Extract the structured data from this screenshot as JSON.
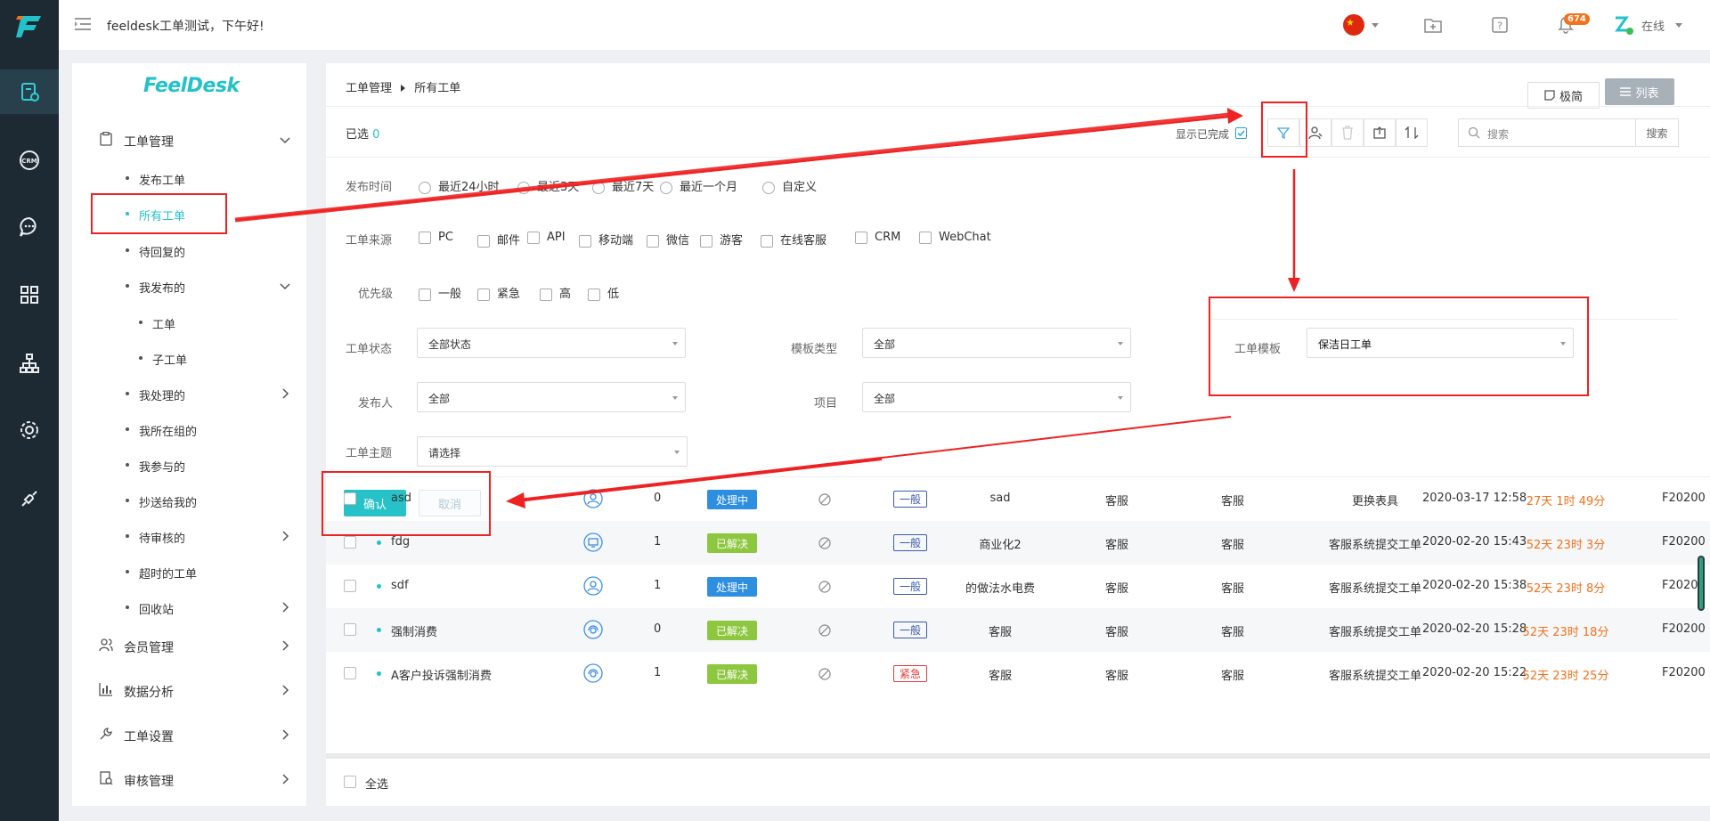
{
  "topbar": {
    "greeting": "feeldesk工单测试，下午好!",
    "notification_count": "674",
    "status": "在线"
  },
  "sidebar": {
    "brand": "FeelDesk",
    "items": [
      {
        "label": "工单管理",
        "icon": "ticket-icon",
        "level": 0,
        "arrow": "down"
      },
      {
        "label": "发布工单",
        "level": 1
      },
      {
        "label": "所有工单",
        "level": 1,
        "active": true
      },
      {
        "label": "待回复的",
        "level": 1
      },
      {
        "label": "我发布的",
        "level": 1,
        "arrow": "down"
      },
      {
        "label": "工单",
        "level": 2
      },
      {
        "label": "子工单",
        "level": 2
      },
      {
        "label": "我处理的",
        "level": 1,
        "arrow": "right"
      },
      {
        "label": "我所在组的",
        "level": 1
      },
      {
        "label": "我参与的",
        "level": 1
      },
      {
        "label": "抄送给我的",
        "level": 1
      },
      {
        "label": "待审核的",
        "level": 1,
        "arrow": "right"
      },
      {
        "label": "超时的工单",
        "level": 1
      },
      {
        "label": "回收站",
        "level": 1,
        "arrow": "right"
      },
      {
        "label": "会员管理",
        "icon": "members-icon",
        "level": 0,
        "arrow": "right"
      },
      {
        "label": "数据分析",
        "icon": "chart-icon",
        "level": 0,
        "arrow": "right"
      },
      {
        "label": "工单设置",
        "icon": "wrench-icon",
        "level": 0,
        "arrow": "right"
      },
      {
        "label": "审核管理",
        "icon": "audit-icon",
        "level": 0,
        "arrow": "right"
      }
    ]
  },
  "breadcrumb": {
    "root": "工单管理",
    "current": "所有工单"
  },
  "view": {
    "simple": "极简",
    "list": "列表"
  },
  "toolbar": {
    "selected_label": "已选",
    "selected_count": "0",
    "show_done": "显示已完成",
    "search_placeholder": "搜索",
    "search_button": "搜索"
  },
  "filters": {
    "publish_time": {
      "label": "发布时间",
      "options": [
        "最近24小时",
        "最近3天",
        "最近7天",
        "最近一个月",
        "自定义"
      ]
    },
    "source": {
      "label": "工单来源",
      "options": [
        "PC",
        "邮件",
        "API",
        "移动端",
        "微信",
        "游客",
        "在线客服",
        "CRM",
        "WebChat"
      ]
    },
    "priority": {
      "label": "优先级",
      "options": [
        "一般",
        "紧急",
        "高",
        "低"
      ]
    },
    "status": {
      "label": "工单状态",
      "value": "全部状态"
    },
    "template_type": {
      "label": "模板类型",
      "value": "全部"
    },
    "template": {
      "label": "工单模板",
      "value": "保洁日工单"
    },
    "publisher": {
      "label": "发布人",
      "value": "全部"
    },
    "project": {
      "label": "项目",
      "value": "全部"
    },
    "subject": {
      "label": "工单主题",
      "value": "请选择"
    },
    "confirm": "确认",
    "cancel": "取消"
  },
  "table": {
    "rows": [
      {
        "title": "asd",
        "count": "0",
        "status": "处理中",
        "status_color": "#2e8ee0",
        "priority": "一般",
        "category": "sad",
        "group1": "客服",
        "group2": "客服",
        "template": "更换表具",
        "time": "2020-03-17 12:58",
        "elapsed": "27天 1时 49分",
        "id": "F20200"
      },
      {
        "title": "fdg",
        "count": "1",
        "status": "已解决",
        "status_color": "#8dc63f",
        "priority": "一般",
        "category": "商业化2",
        "group1": "客服",
        "group2": "客服",
        "template": "客服系统提交工单",
        "time": "2020-02-20 15:43",
        "elapsed": "52天 23时 3分",
        "id": "F20200"
      },
      {
        "title": "sdf",
        "count": "1",
        "status": "处理中",
        "status_color": "#2e8ee0",
        "priority": "一般",
        "category": "的做法水电费",
        "group1": "客服",
        "group2": "客服",
        "template": "客服系统提交工单",
        "time": "2020-02-20 15:38",
        "elapsed": "52天 23时 8分",
        "id": "F20200"
      },
      {
        "title": "强制消费",
        "count": "0",
        "status": "已解决",
        "status_color": "#8dc63f",
        "priority": "一般",
        "category": "客服",
        "group1": "客服",
        "group2": "客服",
        "template": "客服系统提交工单",
        "time": "2020-02-20 15:28",
        "elapsed": "52天 23时 18分",
        "id": "F20200"
      },
      {
        "title": "A客户投诉强制消费",
        "count": "1",
        "status": "已解决",
        "status_color": "#8dc63f",
        "priority": "紧急",
        "category": "客服",
        "group1": "客服",
        "group2": "客服",
        "template": "客服系统提交工单",
        "time": "2020-02-20 15:22",
        "elapsed": "52天 23时 25分",
        "id": "F20200"
      }
    ],
    "select_all": "全选"
  },
  "colors": {
    "accent": "#25c1c8",
    "elapsed": "#f2711c",
    "annotation": "#ee2222"
  }
}
